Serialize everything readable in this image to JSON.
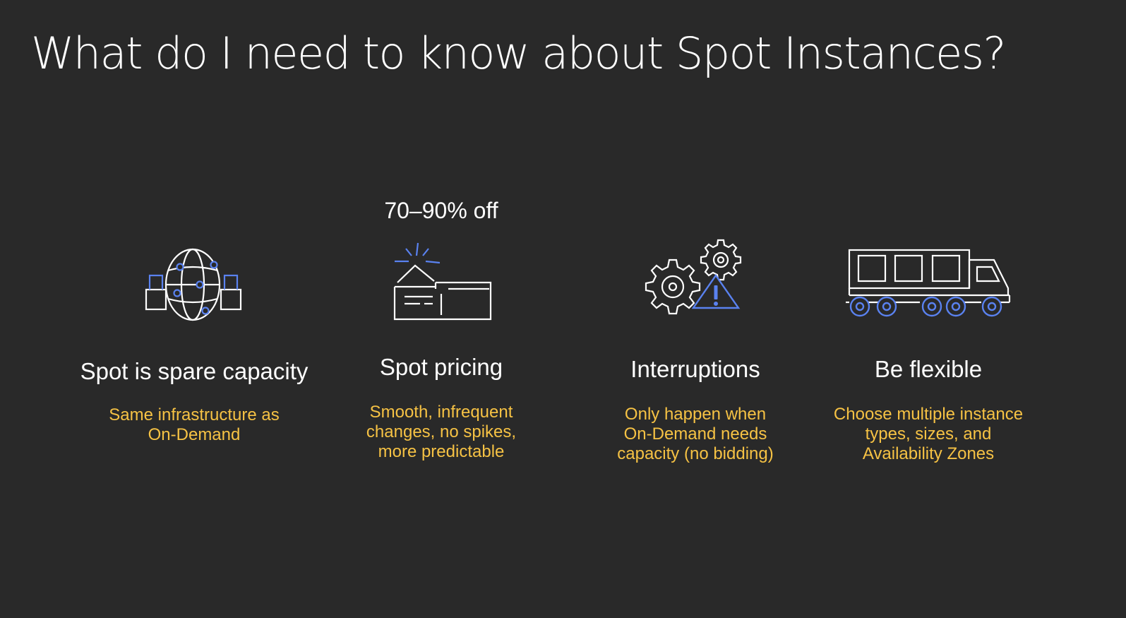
{
  "slide": {
    "title": "What do I need to know about Spot Instances?"
  },
  "colors": {
    "background": "#292929",
    "text": "#ffffff",
    "accent_text": "#f6c244",
    "icon_line": "#ffffff",
    "icon_accent": "#5a82f0"
  },
  "columns": [
    {
      "icon": "globe-with-locks-icon",
      "badge": "",
      "heading": "Spot is spare capacity",
      "description": "Same infrastructure as\nOn-Demand"
    },
    {
      "icon": "price-tag-icon",
      "badge": "70–90% off",
      "heading": "Spot pricing",
      "description": "Smooth, infrequent\nchanges, no spikes,\nmore predictable"
    },
    {
      "icon": "gears-warning-icon",
      "badge": "",
      "heading": "Interruptions",
      "description": "Only happen when\nOn-Demand needs\ncapacity (no bidding)"
    },
    {
      "icon": "truck-icon",
      "badge": "",
      "heading": "Be flexible",
      "description": "Choose multiple instance\ntypes, sizes, and\nAvailability Zones"
    }
  ]
}
